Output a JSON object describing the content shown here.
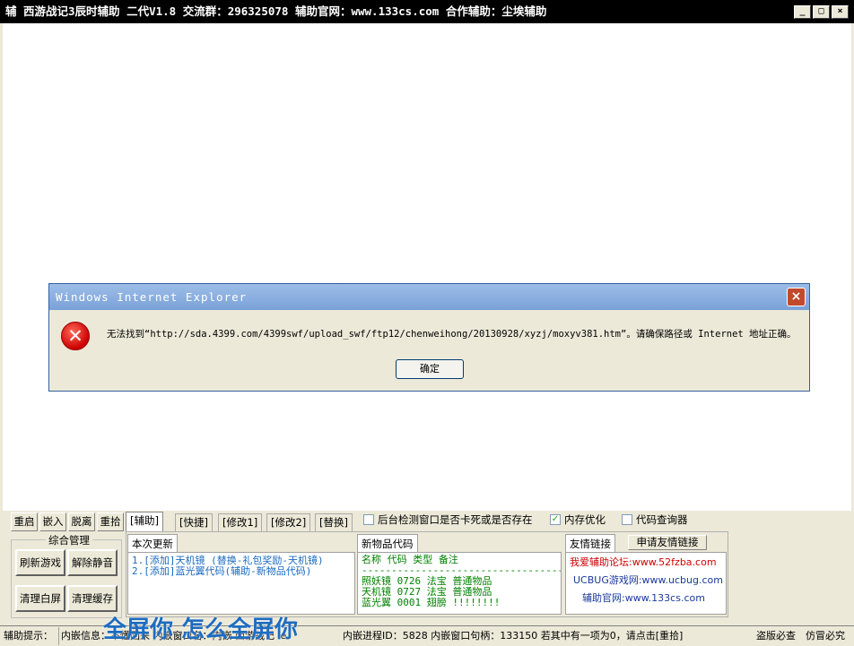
{
  "titlebar": {
    "title": "辅 西游战记3辰时辅助 二代V1.8  交流群：296325078  辅助官网：www.133cs.com  合作辅助：尘埃辅助",
    "btn_min": "_",
    "btn_max": "□",
    "btn_close": "×"
  },
  "dialog": {
    "title": "Windows Internet Explorer",
    "close": "×",
    "icon": "✕",
    "message": "无法找到“http://sda.4399.com/4399swf/upload_swf/ftp12/chenweihong/20130928/xyzj/moxyv381.htm”。请确保路径或 Internet 地址正确。",
    "ok": "确定"
  },
  "toolbar": {
    "restart": "重启",
    "embed": "嵌入",
    "detach": "脱离",
    "pickup": "重拾"
  },
  "group": {
    "title": "综合管理",
    "refresh_game": "刷新游戏",
    "unmute": "解除静音",
    "clear_white": "清理白屏",
    "clear_cache": "清理缓存"
  },
  "tabs": [
    "[辅助]",
    "[快捷]",
    "[修改1]",
    "[修改2]",
    "[替换]"
  ],
  "options": {
    "bg_detect": "后台检测窗口是否卡死或是否存在",
    "mem_opt": "内存优化",
    "code_query": "代码查询器"
  },
  "updates": {
    "header": "本次更新",
    "line1": "1.[添加]天机镜     (替换-礼包奖励-天机镜)",
    "line2": "2.[添加]蓝光翼代码(辅助-新物品代码)"
  },
  "new_items": {
    "header": "新物品代码",
    "columns": "名称    代码    类型    备注",
    "divider": "----------------------------------",
    "row1": "照妖镜  0726    法宝   普通物品",
    "row2": "天机镜  0727    法宝   普通物品",
    "row3": "蓝光翼  0001    翅膀   !!!!!!!!"
  },
  "friend_links": {
    "header": "友情链接",
    "apply": "申请友情链接",
    "link1": "我爱辅助论坛:www.52fzba.com",
    "link2": "UCBUG游戏网:www.ucbug.com",
    "link3": "辅助官网:www.133cs.com"
  },
  "status": {
    "hint": "辅助提示：",
    "info": "内嵌信息：不懂回来  内嵌窗口名：内嵌 西游战记 ie",
    "pid": "内嵌进程ID：5828 内嵌窗口句柄：133150 若其中有一项为0，请点击[重拾]",
    "piracy": "盗版必查",
    "imitate": "仿冒必究"
  },
  "overlay_text": "全屏你  怎么全屏你"
}
